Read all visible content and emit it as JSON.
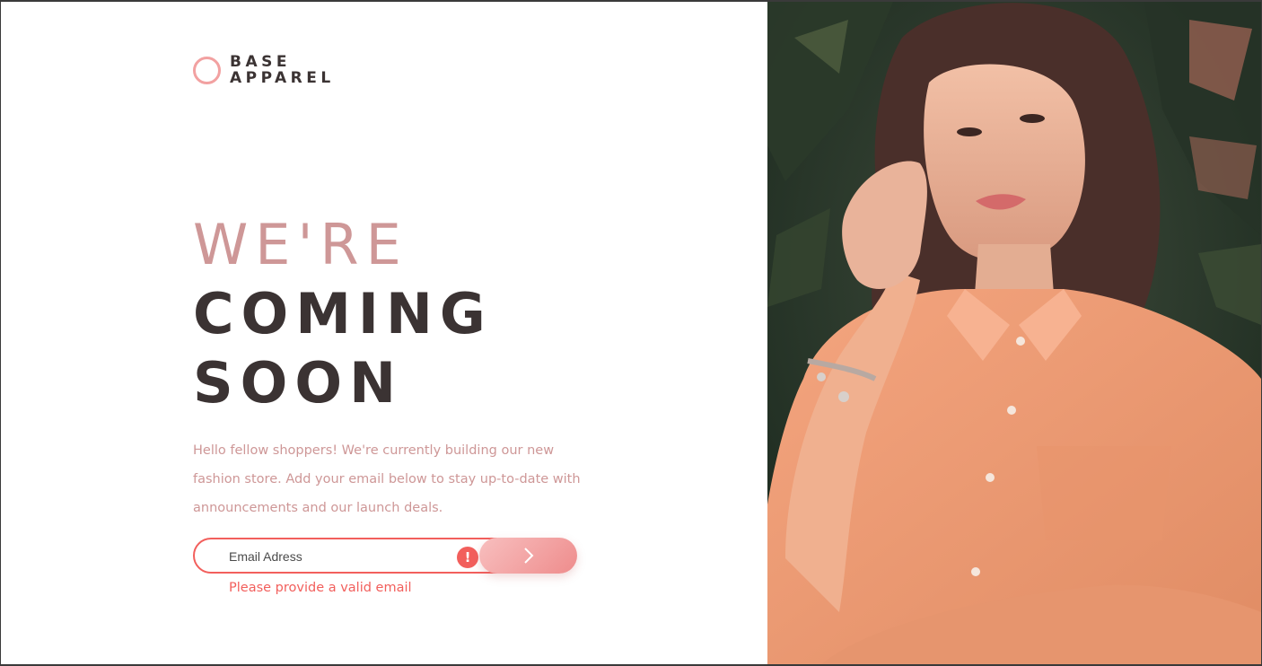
{
  "brand": {
    "line1": "BASE",
    "line2": "APPAREL"
  },
  "hero": {
    "line1": "WE'RE",
    "line2": "COMING",
    "line3": "SOON",
    "description": "Hello fellow shoppers! We're currently building our new fashion store. Add your email below to stay up-to-date with announcements and our launch deals."
  },
  "form": {
    "email_placeholder": "Email Adress",
    "email_value": "",
    "error_icon_glyph": "!",
    "error_message": "Please provide a valid email",
    "submit_icon": "chevron-right-icon"
  },
  "colors": {
    "accent_light": "#ce9797",
    "text_dark": "#3b3333",
    "error_red": "#f25f5c",
    "button_gradient_start": "#f8bfbf",
    "button_gradient_end": "#ee8c8c"
  },
  "hero_image": {
    "subject": "woman-in-peach-shirt-photo"
  }
}
